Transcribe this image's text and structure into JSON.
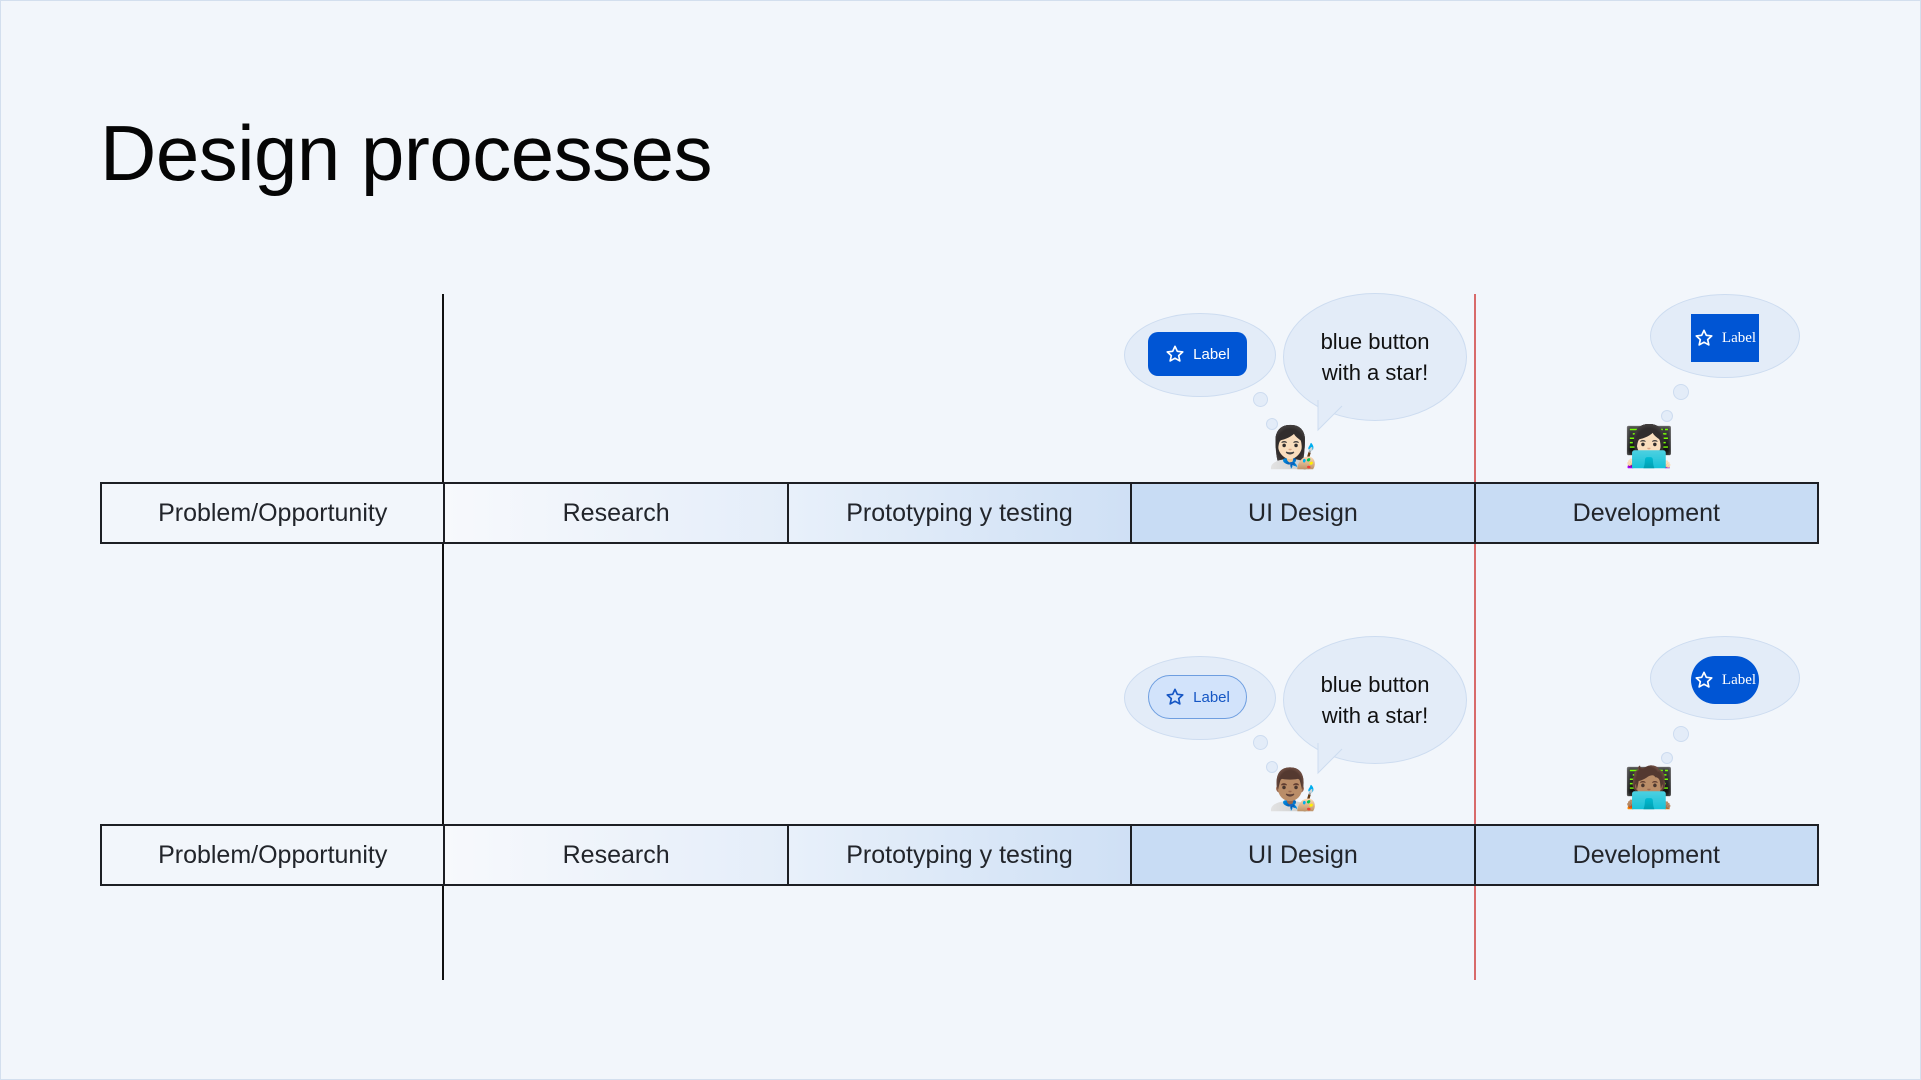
{
  "title": "Design processes",
  "rows": [
    {
      "stages": [
        "Problem/Opportunity",
        "Research",
        "Prototyping y testing",
        "UI Design",
        "Development"
      ],
      "designer": {
        "emoji": "👩🏻‍🎨",
        "thought_button": {
          "label": "Label",
          "icon": "star-outline-icon",
          "style": "filled-rounded"
        },
        "speech": [
          "blue button",
          "with a star!"
        ]
      },
      "developer": {
        "emoji": "👩🏻‍💻",
        "thought_button": {
          "label": "Label",
          "icon": "star-outline-icon",
          "style": "square"
        }
      }
    },
    {
      "stages": [
        "Problem/Opportunity",
        "Research",
        "Prototyping y testing",
        "UI Design",
        "Development"
      ],
      "designer": {
        "emoji": "👨🏽‍🎨",
        "thought_button": {
          "label": "Label",
          "icon": "star-outline-icon",
          "style": "tonal-pill"
        },
        "speech": [
          "blue button",
          "with a star!"
        ]
      },
      "developer": {
        "emoji": "🧑🏽‍💻",
        "thought_button": {
          "label": "Label",
          "icon": "star-outline-icon",
          "style": "filled-pill"
        }
      }
    }
  ],
  "colors": {
    "background": "#f2f6fb",
    "primary_blue": "#0055d4",
    "stage_highlight": "#c8dcf4",
    "divider_red": "#d86a6a"
  }
}
